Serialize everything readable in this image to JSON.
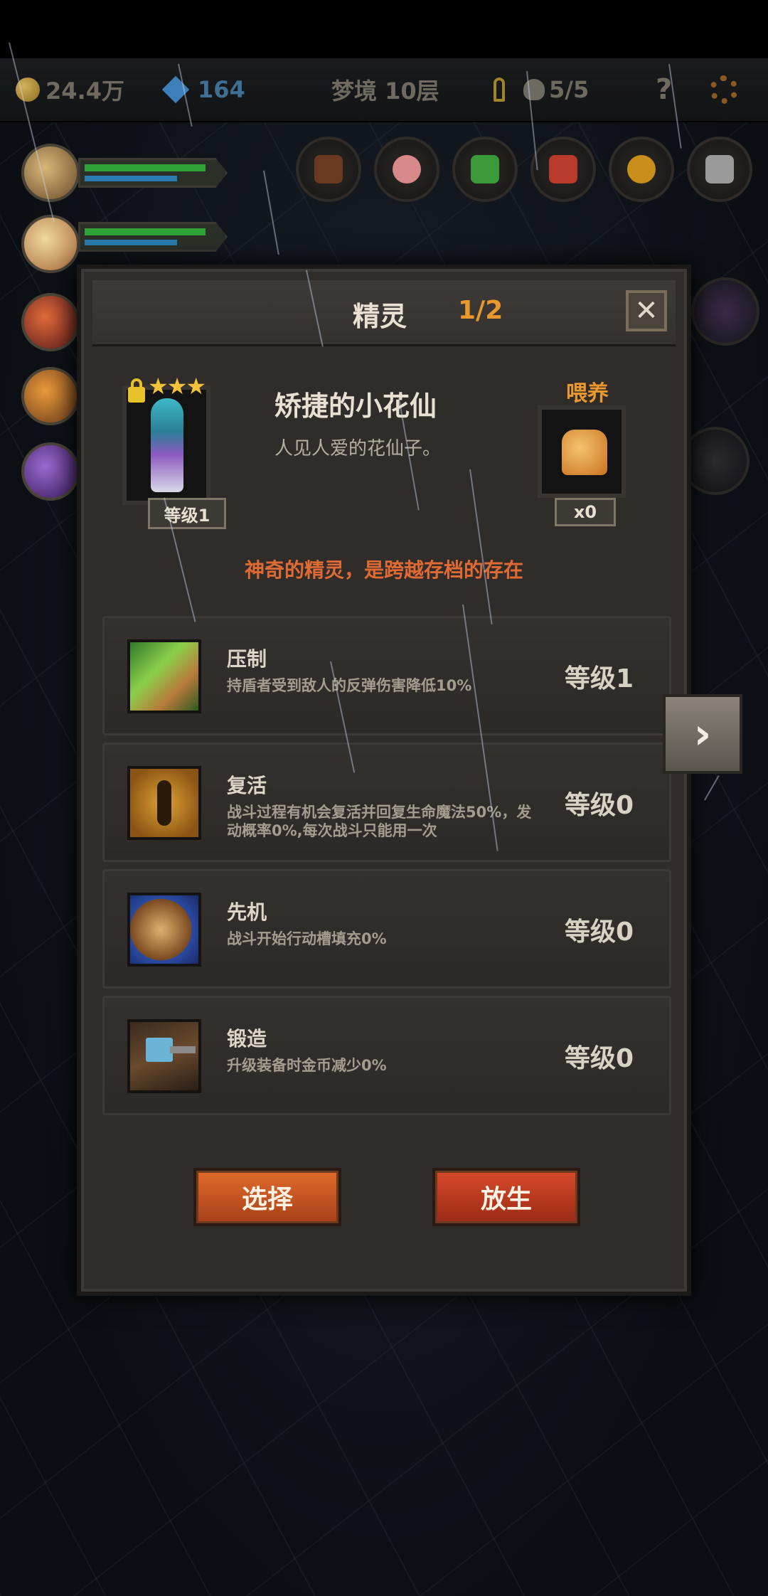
{
  "topbar": {
    "gold": "24.4万",
    "gems": "164",
    "floor": "梦境 10层",
    "lives": "5/5",
    "help": "?"
  },
  "modal": {
    "title": "精灵",
    "count": "1/2",
    "close": "✕",
    "spirit": {
      "stars": "★★★",
      "level": "等级1",
      "name": "矫捷的小花仙",
      "description": "人见人爱的花仙子。"
    },
    "feed": {
      "label": "喂养",
      "count": "x0"
    },
    "slogan": "神奇的精灵，是跨越存档的存在",
    "skills": [
      {
        "name": "压制",
        "description": "持盾者受到敌人的反弹伤害降低10%",
        "level": "等级1",
        "icon": "claw-grass-icon"
      },
      {
        "name": "复活",
        "description": "战斗过程有机会复活并回复生命魔法50%，发动概率0%,每次战斗只能用一次",
        "level": "等级0",
        "icon": "revive-dancer-icon"
      },
      {
        "name": "先机",
        "description": "战斗开始行动槽填充0%",
        "level": "等级0",
        "icon": "leopard-icon"
      },
      {
        "name": "锻造",
        "description": "升级装备时金币减少0%",
        "level": "等级0",
        "icon": "hammer-icon"
      }
    ],
    "buttons": {
      "select": "选择",
      "release": "放生"
    }
  },
  "next_arrow": "›"
}
